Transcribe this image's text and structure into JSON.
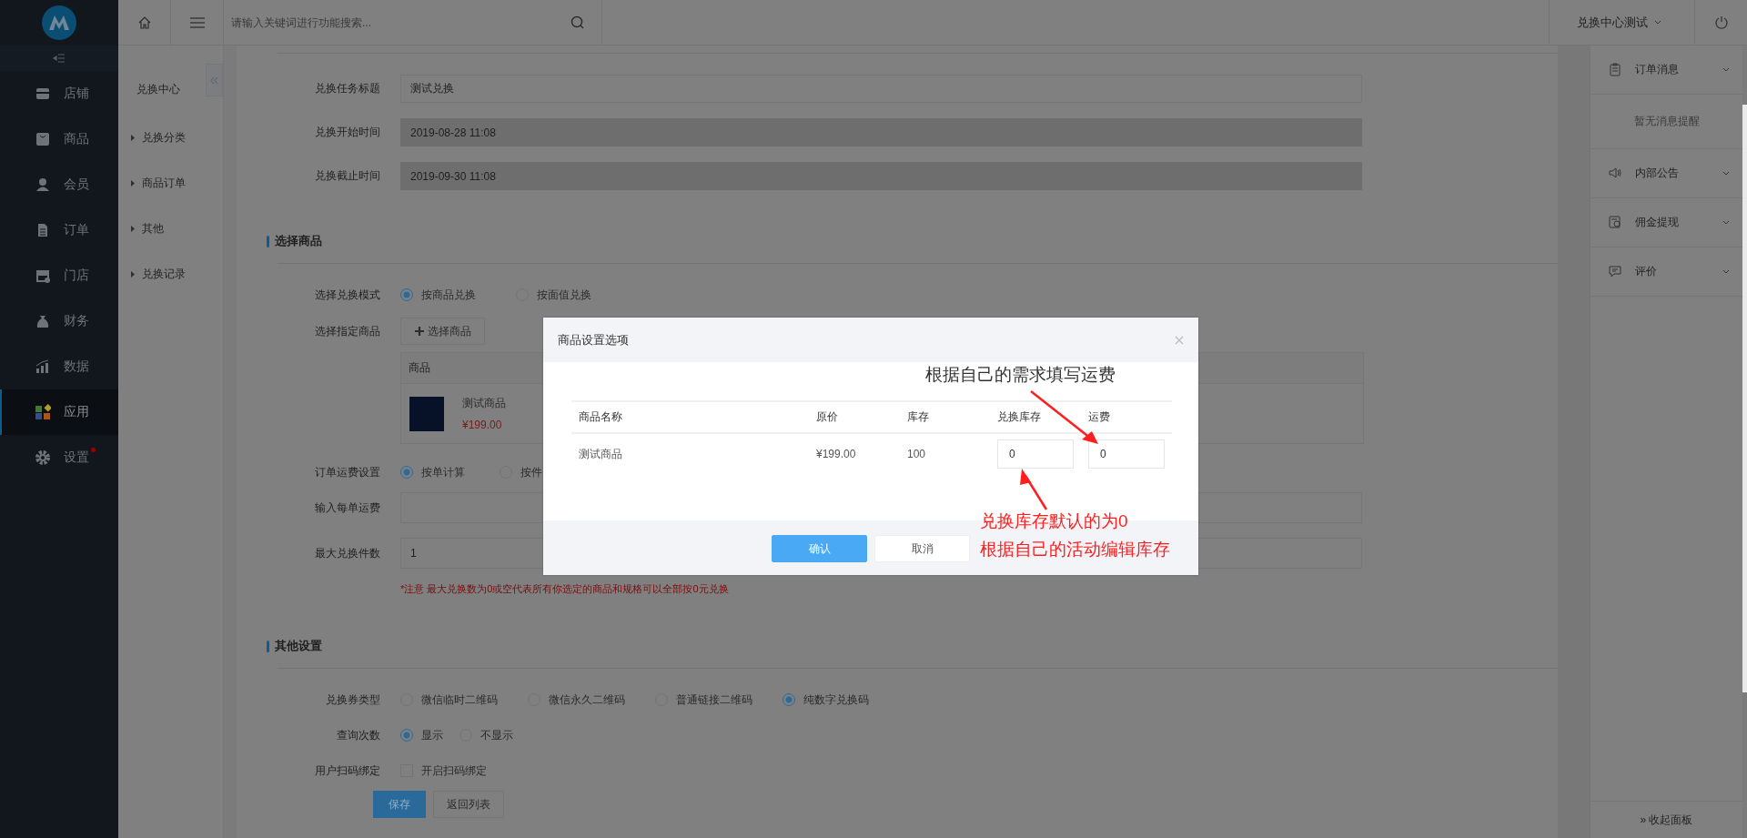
{
  "sidebar": {
    "items": [
      {
        "label": "店铺",
        "selected": false,
        "alert": false
      },
      {
        "label": "商品",
        "selected": false,
        "alert": false
      },
      {
        "label": "会员",
        "selected": false,
        "alert": false
      },
      {
        "label": "订单",
        "selected": false,
        "alert": false
      },
      {
        "label": "门店",
        "selected": false,
        "alert": false
      },
      {
        "label": "财务",
        "selected": false,
        "alert": false
      },
      {
        "label": "数据",
        "selected": false,
        "alert": false
      },
      {
        "label": "应用",
        "selected": true,
        "alert": false
      },
      {
        "label": "设置",
        "selected": false,
        "alert": true
      }
    ]
  },
  "topbar": {
    "search": {
      "placeholder": "请输入关键词进行功能搜索..."
    },
    "account": "兑换中心测试"
  },
  "subnav": {
    "title": "兑换中心",
    "items": [
      "兑换分类",
      "商品订单",
      "其他",
      "兑换记录"
    ]
  },
  "form": {
    "basic_fields": [
      {
        "label": "兑换任务标题",
        "value": "测试兑换",
        "disabled": false
      },
      {
        "label": "兑换开始时间",
        "value": "2019-08-28 11:08",
        "disabled": true
      },
      {
        "label": "兑换截止时间",
        "value": "2019-09-30 11:08",
        "disabled": true
      }
    ],
    "goods_section": {
      "title": "选择商品",
      "mode": {
        "label": "选择兑换模式",
        "options": [
          {
            "label": "按商品兑换",
            "selected": true
          },
          {
            "label": "按面值兑换",
            "selected": false
          }
        ]
      },
      "goods": {
        "label": "选择指定商品",
        "button": "选择商品",
        "columns": [
          "商品"
        ],
        "rows": [
          {
            "name": "测试商品",
            "price": "¥199.00"
          }
        ]
      },
      "shipping": {
        "label": "订单运费设置",
        "options": [
          {
            "label": "按单计算",
            "selected": true
          },
          {
            "label": "按件",
            "selected": false
          }
        ]
      },
      "fee": {
        "label": "输入每单运费"
      },
      "max": {
        "label": "最大兑换件数",
        "value": "1"
      },
      "note": "*注意 最大兑换数为0或空代表所有你选定的商品和规格可以全部按0元兑换"
    },
    "other_section": {
      "title": "其他设置",
      "voucher_type": {
        "label": "兑换券类型",
        "options": [
          {
            "label": "微信临时二维码",
            "selected": false
          },
          {
            "label": "微信永久二维码",
            "selected": false
          },
          {
            "label": "普通链接二维码",
            "selected": false
          },
          {
            "label": "纯数字兑换码",
            "selected": true
          }
        ]
      },
      "query_count": {
        "label": "查询次数",
        "options": [
          {
            "label": "显示",
            "selected": true
          },
          {
            "label": "不显示",
            "selected": false
          }
        ]
      },
      "scan_bind": {
        "label": "用户扫码绑定",
        "checkbox": {
          "label": "开启扫码绑定",
          "checked": false
        }
      }
    },
    "buttons": [
      {
        "label": "保存",
        "kind": "primary"
      },
      {
        "label": "返回列表",
        "kind": "default"
      }
    ]
  },
  "right_panel": {
    "sections": [
      {
        "title": "订单消息",
        "message": "暂无消息提醒"
      },
      {
        "title": "内部公告"
      },
      {
        "title": "佣金提现"
      },
      {
        "title": "评价"
      }
    ],
    "collapse": "» 收起面板"
  },
  "modal": {
    "title": "商品设置选项",
    "columns": [
      "商品名称",
      "原价",
      "库存",
      "兑换库存",
      "运费"
    ],
    "rows": [
      {
        "name": "测试商品",
        "price": "¥199.00",
        "stock": "100",
        "exchange_stock": "0",
        "shipping": "0"
      }
    ],
    "buttons": [
      {
        "label": "确认",
        "kind": "primary"
      },
      {
        "label": "取消",
        "kind": "default"
      }
    ]
  },
  "annotations": [
    {
      "text": "根据自己的需求填写运费",
      "color": "#333333"
    },
    {
      "text": "兑换库存默认的为0",
      "color": "#ff1e1e"
    },
    {
      "text": "根据自己的活动编辑库存",
      "color": "#ff1e1e"
    }
  ]
}
